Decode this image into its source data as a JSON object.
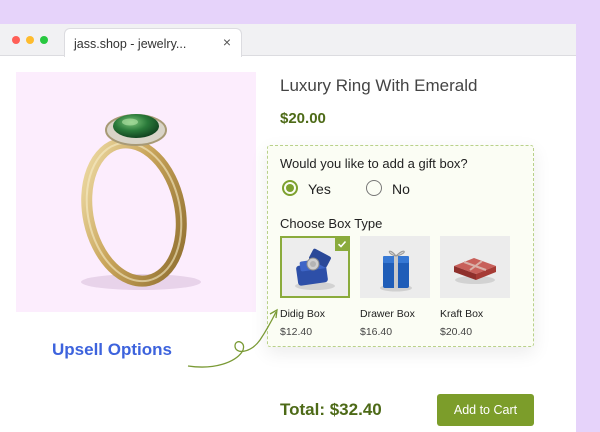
{
  "browser": {
    "tab_title": "jass.shop - jewelry...",
    "close_glyph": "×",
    "traffic_lights": [
      "#ff5f57",
      "#febc2e",
      "#28c840"
    ]
  },
  "product": {
    "title": "Luxury Ring With Emerald",
    "price": "$20.00",
    "image_icon": "emerald-ring-image"
  },
  "upsell": {
    "question": "Would you like to add a gift box?",
    "yes_label": "Yes",
    "no_label": "No",
    "selected": "Yes",
    "choose_label": "Choose Box Type",
    "options": [
      {
        "name": "Didig Box",
        "price": "$12.40",
        "icon": "didig-box-image",
        "selected": true
      },
      {
        "name": "Drawer Box",
        "price": "$16.40",
        "icon": "drawer-box-image",
        "selected": false
      },
      {
        "name": "Kraft Box",
        "price": "$20.40",
        "icon": "kraft-box-image",
        "selected": false
      }
    ]
  },
  "annotation": {
    "label": "Upsell Options",
    "color": "#3d63dd"
  },
  "footer": {
    "total": "Total: $32.40",
    "add_to_cart": "Add to Cart"
  },
  "colors": {
    "accent": "#7c9d2a",
    "price_text": "#4d6a17",
    "page_background": "#e6d3fa"
  }
}
